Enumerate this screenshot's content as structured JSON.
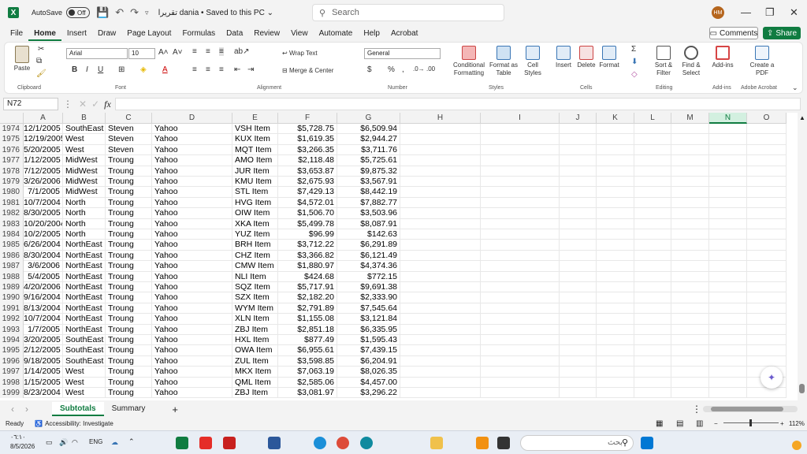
{
  "window": {
    "autosave_label": "AutoSave",
    "autosave_state": "Off",
    "doc_title": "تقريرا dania • Saved to this PC ⌄",
    "search_placeholder": "Search",
    "user_initials": "HM"
  },
  "menu": {
    "items": [
      "File",
      "Home",
      "Insert",
      "Draw",
      "Page Layout",
      "Formulas",
      "Data",
      "Review",
      "View",
      "Automate",
      "Help",
      "Acrobat"
    ],
    "active": "Home",
    "comments": "Comments",
    "share": "Share"
  },
  "ribbon": {
    "groups": [
      "Clipboard",
      "Font",
      "Alignment",
      "Number",
      "Styles",
      "Cells",
      "Editing",
      "Add-ins",
      "Adobe Acrobat"
    ],
    "paste": "Paste",
    "font_name": "Arial",
    "font_size": "10",
    "wrap_text": "Wrap Text",
    "merge_center": "Merge & Center",
    "number_format": "General",
    "conditional_formatting": "Conditional Formatting",
    "format_as_table": "Format as Table",
    "cell_styles": "Cell Styles",
    "insert": "Insert",
    "delete": "Delete",
    "format": "Format",
    "sort_filter": "Sort & Filter",
    "find_select": "Find & Select",
    "addins": "Add-ins",
    "create_pdf": "Create a PDF"
  },
  "formula_bar": {
    "name_box": "N72",
    "fx": "fx",
    "content": ""
  },
  "grid": {
    "columns": [
      "A",
      "B",
      "C",
      "D",
      "E",
      "F",
      "G",
      "H",
      "I",
      "J",
      "K",
      "L",
      "M",
      "N",
      "O"
    ],
    "selected_column": "N",
    "rows": [
      {
        "n": "1974",
        "a": "12/1/2005",
        "b": "SouthEast",
        "c": "Steven",
        "d": "Yahoo",
        "e": "VSH Item",
        "f": "$5,728.75",
        "g": "$6,509.94"
      },
      {
        "n": "1975",
        "a": "12/19/2005",
        "b": "West",
        "c": "Steven",
        "d": "Yahoo",
        "e": "KUX Item",
        "f": "$1,619.35",
        "g": "$2,944.27"
      },
      {
        "n": "1976",
        "a": "5/20/2005",
        "b": "West",
        "c": "Steven",
        "d": "Yahoo",
        "e": "MQT Item",
        "f": "$3,266.35",
        "g": "$3,711.76"
      },
      {
        "n": "1977",
        "a": "1/12/2005",
        "b": "MidWest",
        "c": "Troung",
        "d": "Yahoo",
        "e": "AMO Item",
        "f": "$2,118.48",
        "g": "$5,725.61"
      },
      {
        "n": "1978",
        "a": "7/12/2005",
        "b": "MidWest",
        "c": "Troung",
        "d": "Yahoo",
        "e": "JUR Item",
        "f": "$3,653.87",
        "g": "$9,875.32"
      },
      {
        "n": "1979",
        "a": "3/26/2006",
        "b": "MidWest",
        "c": "Troung",
        "d": "Yahoo",
        "e": "KMU Item",
        "f": "$2,675.93",
        "g": "$3,567.91"
      },
      {
        "n": "1980",
        "a": "7/1/2005",
        "b": "MidWest",
        "c": "Troung",
        "d": "Yahoo",
        "e": "STL Item",
        "f": "$7,429.13",
        "g": "$8,442.19"
      },
      {
        "n": "1981",
        "a": "10/7/2004",
        "b": "North",
        "c": "Troung",
        "d": "Yahoo",
        "e": "HVG Item",
        "f": "$4,572.01",
        "g": "$7,882.77"
      },
      {
        "n": "1982",
        "a": "8/30/2005",
        "b": "North",
        "c": "Troung",
        "d": "Yahoo",
        "e": "OIW Item",
        "f": "$1,506.70",
        "g": "$3,503.96"
      },
      {
        "n": "1983",
        "a": "10/20/2004",
        "b": "North",
        "c": "Troung",
        "d": "Yahoo",
        "e": "XKA Item",
        "f": "$5,499.78",
        "g": "$8,087.91"
      },
      {
        "n": "1984",
        "a": "10/2/2005",
        "b": "North",
        "c": "Troung",
        "d": "Yahoo",
        "e": "YUZ Item",
        "f": "$96.99",
        "g": "$142.63"
      },
      {
        "n": "1985",
        "a": "6/26/2004",
        "b": "NorthEast",
        "c": "Troung",
        "d": "Yahoo",
        "e": "BRH Item",
        "f": "$3,712.22",
        "g": "$6,291.89"
      },
      {
        "n": "1986",
        "a": "8/30/2004",
        "b": "NorthEast",
        "c": "Troung",
        "d": "Yahoo",
        "e": "CHZ Item",
        "f": "$3,366.82",
        "g": "$6,121.49"
      },
      {
        "n": "1987",
        "a": "3/6/2006",
        "b": "NorthEast",
        "c": "Troung",
        "d": "Yahoo",
        "e": "CMW Item",
        "f": "$1,880.97",
        "g": "$4,374.36"
      },
      {
        "n": "1988",
        "a": "5/4/2005",
        "b": "NorthEast",
        "c": "Troung",
        "d": "Yahoo",
        "e": "NLI Item",
        "f": "$424.68",
        "g": "$772.15"
      },
      {
        "n": "1989",
        "a": "4/20/2006",
        "b": "NorthEast",
        "c": "Troung",
        "d": "Yahoo",
        "e": "SQZ Item",
        "f": "$5,717.91",
        "g": "$9,691.38"
      },
      {
        "n": "1990",
        "a": "9/16/2004",
        "b": "NorthEast",
        "c": "Troung",
        "d": "Yahoo",
        "e": "SZX Item",
        "f": "$2,182.20",
        "g": "$2,333.90"
      },
      {
        "n": "1991",
        "a": "8/13/2004",
        "b": "NorthEast",
        "c": "Troung",
        "d": "Yahoo",
        "e": "WYM Item",
        "f": "$2,791.89",
        "g": "$7,545.64"
      },
      {
        "n": "1992",
        "a": "10/7/2004",
        "b": "NorthEast",
        "c": "Troung",
        "d": "Yahoo",
        "e": "XLN Item",
        "f": "$1,155.08",
        "g": "$3,121.84"
      },
      {
        "n": "1993",
        "a": "1/7/2005",
        "b": "NorthEast",
        "c": "Troung",
        "d": "Yahoo",
        "e": "ZBJ Item",
        "f": "$2,851.18",
        "g": "$6,335.95"
      },
      {
        "n": "1994",
        "a": "3/20/2005",
        "b": "SouthEast",
        "c": "Troung",
        "d": "Yahoo",
        "e": "HXL Item",
        "f": "$877.49",
        "g": "$1,595.43"
      },
      {
        "n": "1995",
        "a": "2/12/2005",
        "b": "SouthEast",
        "c": "Troung",
        "d": "Yahoo",
        "e": "OWA Item",
        "f": "$6,955.61",
        "g": "$7,439.15"
      },
      {
        "n": "1996",
        "a": "9/18/2005",
        "b": "SouthEast",
        "c": "Troung",
        "d": "Yahoo",
        "e": "ZUL Item",
        "f": "$3,598.85",
        "g": "$6,204.91"
      },
      {
        "n": "1997",
        "a": "1/14/2005",
        "b": "West",
        "c": "Troung",
        "d": "Yahoo",
        "e": "MKX Item",
        "f": "$7,063.19",
        "g": "$8,026.35"
      },
      {
        "n": "1998",
        "a": "1/15/2005",
        "b": "West",
        "c": "Troung",
        "d": "Yahoo",
        "e": "QML Item",
        "f": "$2,585.06",
        "g": "$4,457.00"
      },
      {
        "n": "1999",
        "a": "8/23/2004",
        "b": "West",
        "c": "Troung",
        "d": "Yahoo",
        "e": "ZBJ Item",
        "f": "$3,081.97",
        "g": "$3,296.22"
      }
    ]
  },
  "sheets": {
    "tabs": [
      "Subtotals",
      "Summary"
    ],
    "active": "Subtotals"
  },
  "status": {
    "ready": "Ready",
    "accessibility": "Accessibility: Investigate",
    "zoom": "112%"
  },
  "taskbar": {
    "time": "٠٦:١٠",
    "date": "8/5/2026",
    "lang": "ENG",
    "search_placeholder": "بحث"
  }
}
